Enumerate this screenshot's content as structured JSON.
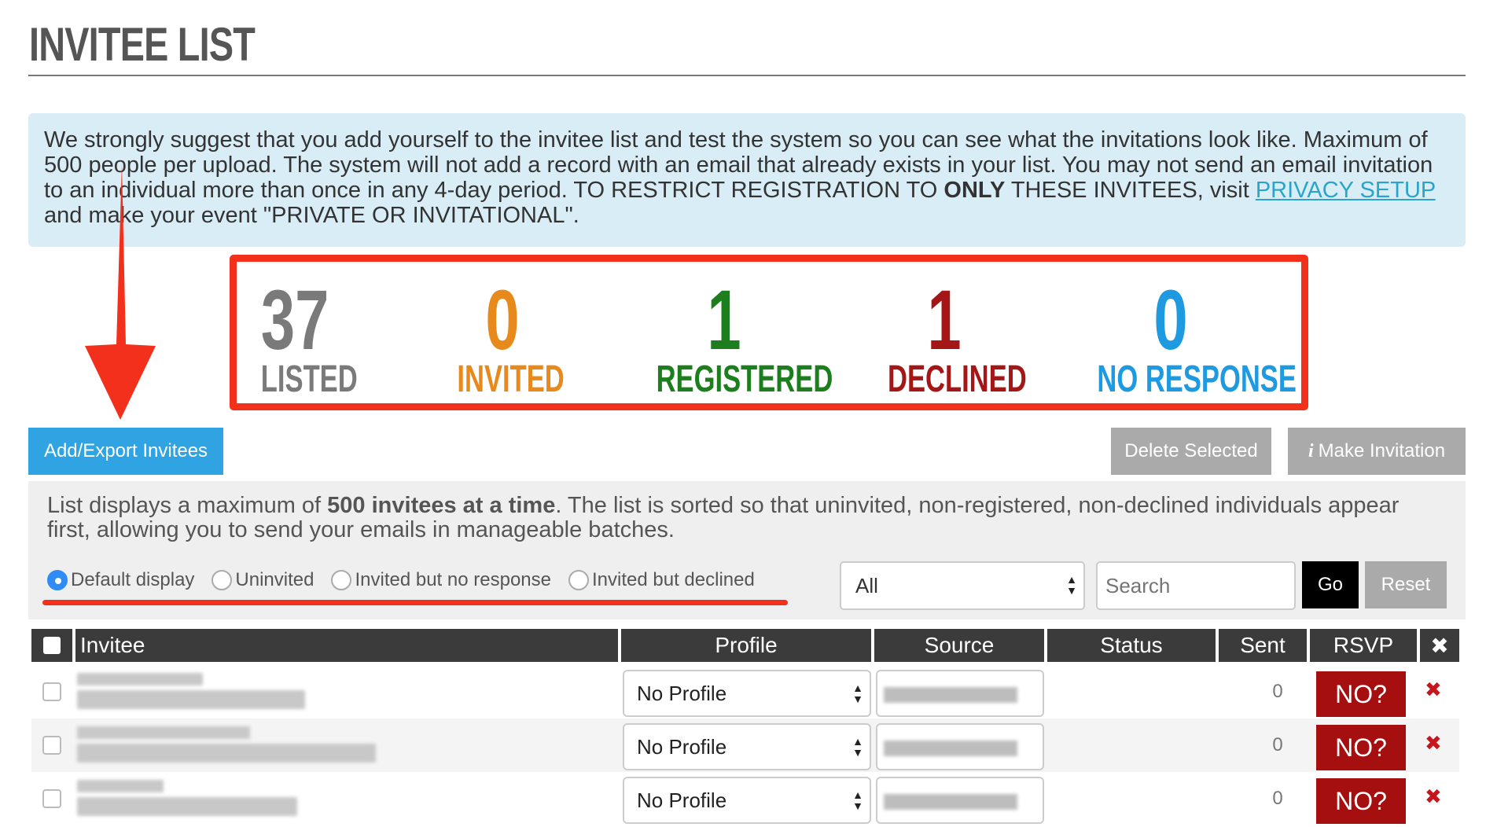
{
  "header": {
    "title": "INVITEE LIST"
  },
  "info": {
    "text_1": "We strongly suggest that you add yourself to the invitee list and test the system so you can see what the invitations look like. Maximum of 500 people per upload. The system will not add a record with an email that already exists in your list. You may not send an email invitation to an individual more than once in any 4-day period. TO RESTRICT REGISTRATION TO ",
    "bold": "ONLY",
    "text_2": " THESE INVITEES, visit ",
    "link": "PRIVACY SETUP",
    "text_3": " and make your event \"PRIVATE OR INVITATIONAL\"."
  },
  "stats": [
    {
      "value": "37",
      "label": "LISTED",
      "color": "#7a7a7a"
    },
    {
      "value": "0",
      "label": "INVITED",
      "color": "#e8891b"
    },
    {
      "value": "1",
      "label": "REGISTERED",
      "color": "#1d7e1d"
    },
    {
      "value": "1",
      "label": "DECLINED",
      "color": "#a51616"
    },
    {
      "value": "0",
      "label": "NO RESPONSE",
      "color": "#1e9ae0"
    }
  ],
  "toolbar": {
    "add_export": "Add/Export Invitees",
    "delete_selected": "Delete Selected",
    "make_invitation_icon": "i",
    "make_invitation": "Make Invitation"
  },
  "filter": {
    "desc_1": "List displays a maximum of ",
    "desc_bold": "500 invitees at a time",
    "desc_2": ". The list is sorted so that uninvited, non-registered, non-declined individuals appear first, allowing you to send your emails in manageable batches.",
    "radios": [
      {
        "label": "Default display",
        "selected": true
      },
      {
        "label": "Uninvited",
        "selected": false
      },
      {
        "label": "Invited but no response",
        "selected": false
      },
      {
        "label": "Invited but declined",
        "selected": false
      }
    ],
    "select_value": "All",
    "search_placeholder": "Search",
    "go": "Go",
    "reset": "Reset"
  },
  "table": {
    "headers": {
      "invitee": "Invitee",
      "profile": "Profile",
      "source": "Source",
      "status": "Status",
      "sent": "Sent",
      "rsvp": "RSVP",
      "delete": "✖"
    },
    "rows": [
      {
        "profile": "No Profile",
        "status": "",
        "sent": "0",
        "rsvp": "NO?"
      },
      {
        "profile": "No Profile",
        "status": "",
        "sent": "0",
        "rsvp": "NO?"
      },
      {
        "profile": "No Profile",
        "status": "",
        "sent": "0",
        "rsvp": "NO?"
      }
    ]
  },
  "annotation_color": "#f2301c"
}
